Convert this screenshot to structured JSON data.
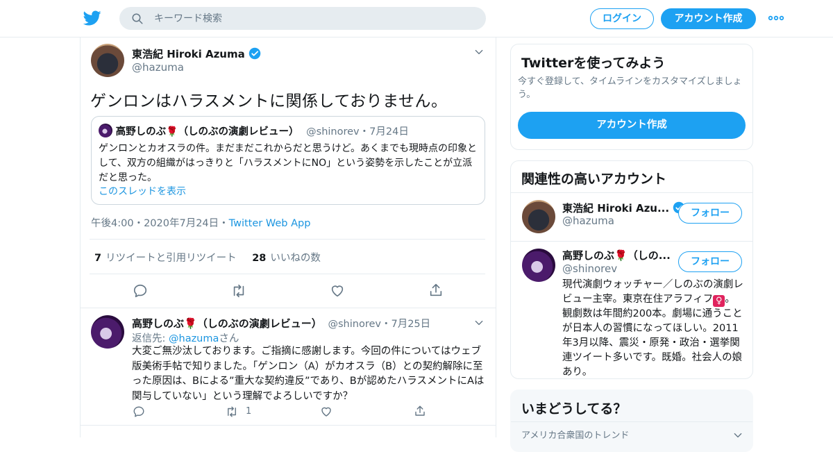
{
  "header": {
    "search_placeholder": "キーワード検索",
    "login_label": "ログイン",
    "signup_label": "アカウント作成"
  },
  "main_tweet": {
    "name": "東浩紀 Hiroki Azuma",
    "handle": "@hazuma",
    "text": "ゲンロンはハラスメントに関係しておりません。",
    "quote": {
      "name": "高野しのぶ",
      "name_suffix": "（しのぶの演劇レビュー）",
      "rose": "🌹",
      "handle": "@shinorev",
      "dot": "・",
      "date": "7月24日",
      "text": "ゲンロンとカオスラの件。まだまだこれからだと思うけど。あくまでも現時点の印象として、双方の組織がはっきりと「ハラスメントにNO」という姿勢を示したことが立派だと思った。",
      "link": "このスレッドを表示"
    },
    "time": "午後4:00",
    "sep1": "・",
    "date": "2020年7月24日",
    "sep2": "・",
    "app": "Twitter Web App",
    "retweet_count": "7",
    "retweet_label": "リツイートと引用リツイート",
    "like_count": "28",
    "like_label": "いいねの数"
  },
  "reply_tweet": {
    "name": "高野しのぶ",
    "rose": "🌹",
    "name_suffix": "（しのぶの演劇レビュー）",
    "handle": "@shinorev",
    "dot": "・",
    "date": "7月25日",
    "reply_prefix": "返信先: ",
    "reply_to": "@hazuma",
    "reply_suffix": "さん",
    "text": "大変ご無沙汰しております。ご指摘に感謝します。今回の件についてはウェブ版美術手帖で知りました。「ゲンロン（A）がカオスラ（B）との契約解除に至った原因は、Bによる”重大な契約違反”であり、Bが認めたハラスメントにAは関与していない」という理解でよろしいですか？",
    "retweet_count": "1"
  },
  "sidebar": {
    "try_card": {
      "title": "Twitterを使ってみよう",
      "subtitle": "今すぐ登録して、タイムラインをカスタマイズしましょう。",
      "button": "アカウント作成"
    },
    "related": {
      "title": "関連性の高いアカウント",
      "follow_label": "フォロー",
      "accounts": [
        {
          "name": "東浩紀 Hiroki Azu...",
          "handle": "@hazuma"
        },
        {
          "name": "高野しのぶ",
          "rose": "🌹",
          "name_suffix": "（しの...",
          "handle": "@shinorev",
          "bio_1": "現代演劇ウォッチャー／しのぶの演劇レビュー主宰。東京在住アラフィフ",
          "bio_female": "♀",
          "bio_2": "。観劇数は年間約200本。劇場に通うことが日本人の習慣になってほしい。2011年3月以降、震災・原発・政治・選挙関連ツイート多いです。既婚。社会人の娘あり。"
        }
      ]
    },
    "trends": {
      "title": "いまどうしてる？",
      "subtitle": "アメリカ合衆国のトレンド"
    }
  },
  "colors": {
    "accent": "#1da1f2",
    "link": "#1b95e0",
    "muted": "#657786",
    "border": "#e6ecf0"
  }
}
